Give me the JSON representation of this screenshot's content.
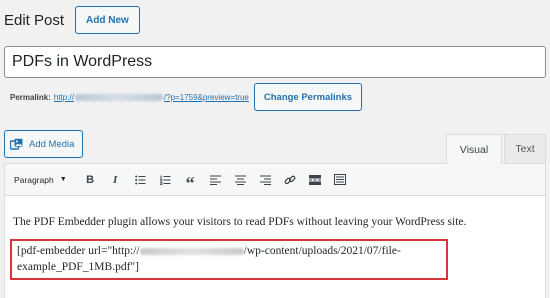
{
  "header": {
    "title": "Edit Post",
    "add_new_label": "Add New"
  },
  "post": {
    "title_value": "PDFs in WordPress"
  },
  "permalink": {
    "label": "Permalink:",
    "url_prefix": "http://",
    "url_blurred_segment": "localhost/wordpress",
    "url_suffix": "/?p=1759&preview=true",
    "change_button_label": "Change Permalinks"
  },
  "media": {
    "add_media_label": "Add Media"
  },
  "editor_tabs": [
    {
      "label": "Visual",
      "active": true
    },
    {
      "label": "Text",
      "active": false
    }
  ],
  "toolbar": {
    "format_select_value": "Paragraph",
    "buttons": [
      {
        "name": "bold",
        "glyph": "B"
      },
      {
        "name": "italic",
        "glyph": "I"
      },
      {
        "name": "bulleted-list",
        "icon": "bullet-list-icon"
      },
      {
        "name": "numbered-list",
        "icon": "numbered-list-icon"
      },
      {
        "name": "blockquote",
        "glyph": "“"
      },
      {
        "name": "align-left",
        "icon": "align-left-icon"
      },
      {
        "name": "align-center",
        "icon": "align-center-icon"
      },
      {
        "name": "align-right",
        "icon": "align-right-icon"
      },
      {
        "name": "insert-link",
        "icon": "link-icon"
      },
      {
        "name": "read-more",
        "icon": "read-more-icon"
      },
      {
        "name": "toolbar-toggle",
        "icon": "kitchen-sink-icon"
      }
    ]
  },
  "content": {
    "paragraph": "The PDF Embedder plugin allows your visitors to read PDFs without leaving your WordPress site.",
    "shortcode_prefix": "[pdf-embedder url=\"http://",
    "shortcode_blurred_segment": "localhost/wordpress",
    "shortcode_suffix": "/wp-content/uploads/2021/07/file-example_PDF_1MB.pdf\"]"
  },
  "colors": {
    "accent": "#2271b1",
    "highlight_border": "#d63638",
    "page_background": "#f1f1f1"
  }
}
